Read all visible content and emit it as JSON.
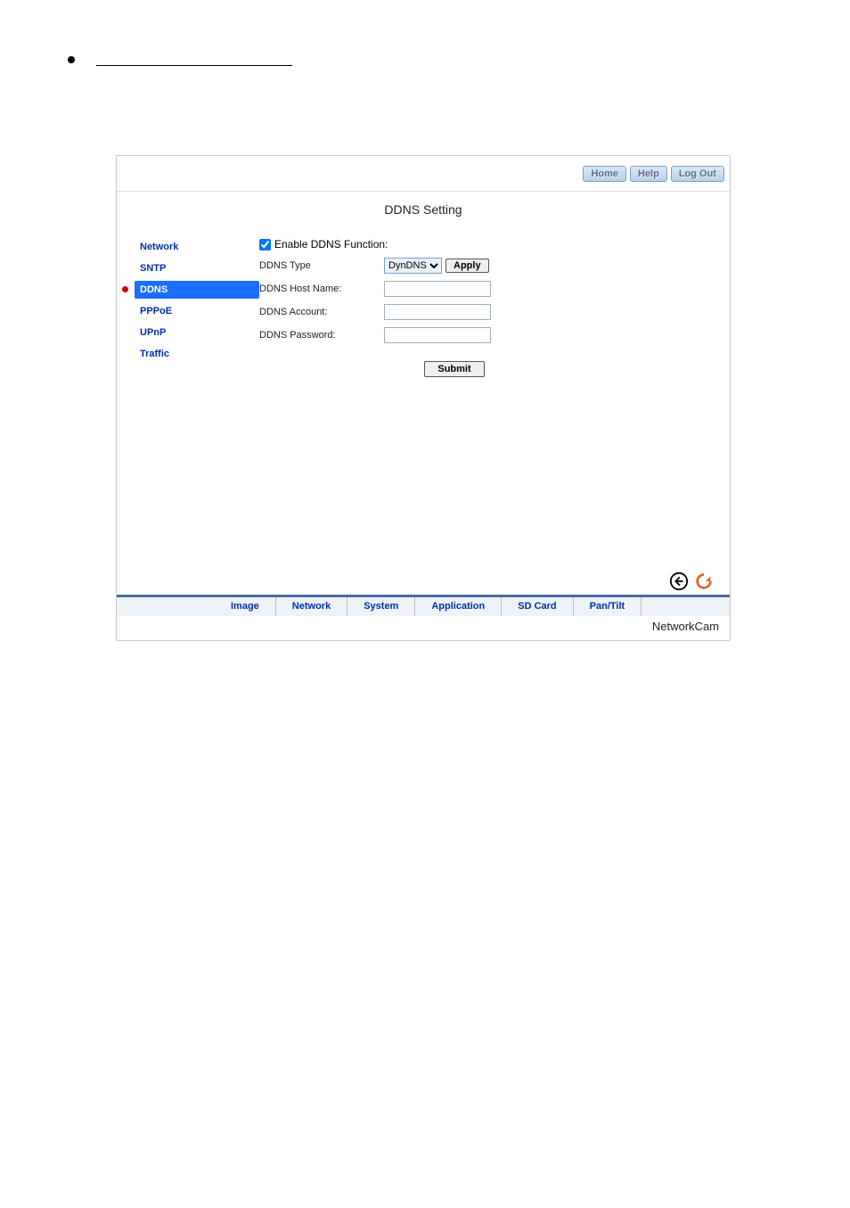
{
  "top": {
    "home": "Home",
    "help": "Help",
    "logout": "Log Out"
  },
  "title": "DDNS Setting",
  "sidebar": {
    "items": [
      "Network",
      "SNTP",
      "DDNS",
      "PPPoE",
      "UPnP",
      "Traffic"
    ]
  },
  "form": {
    "enable_label": "Enable DDNS Function:",
    "enable_checked": true,
    "type_label": "DDNS Type",
    "type_value": "DynDNS",
    "apply": "Apply",
    "host_label": "DDNS Host Name:",
    "host_value": "",
    "acct_label": "DDNS Account:",
    "acct_value": "",
    "pass_label": "DDNS Password:",
    "pass_value": "",
    "submit": "Submit"
  },
  "tabs": [
    "Image",
    "Network",
    "System",
    "Application",
    "SD Card",
    "Pan/Tilt"
  ],
  "brand": "NetworkCam"
}
